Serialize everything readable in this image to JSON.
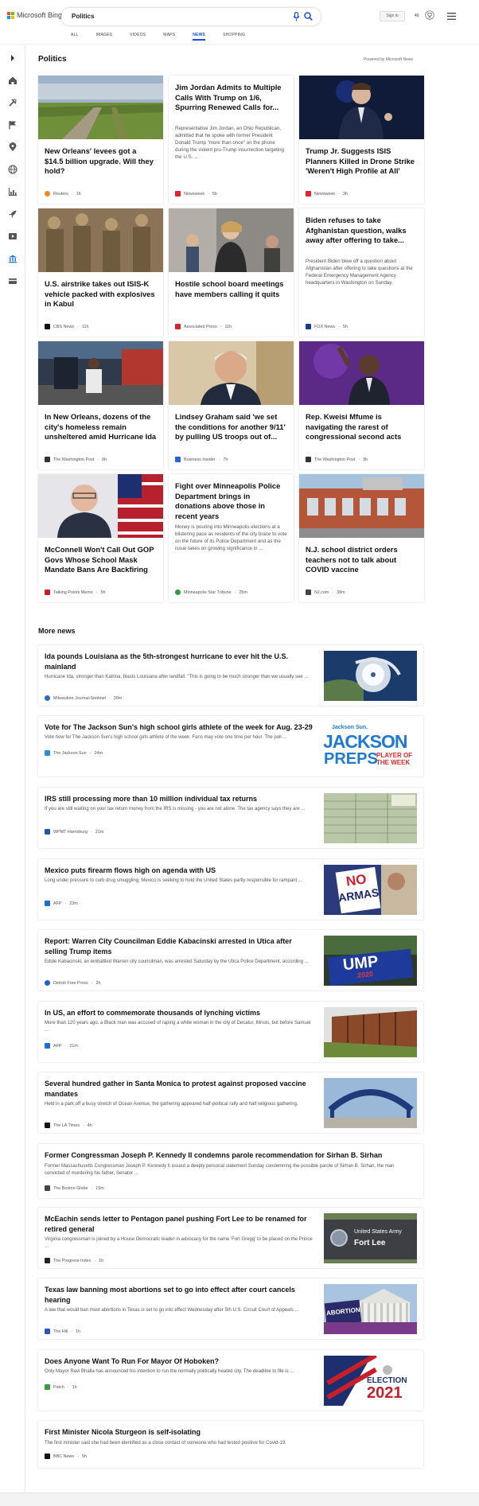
{
  "header": {
    "logo_text": "Microsoft Bing",
    "search_query": "Politics",
    "signin_label": "Sign in",
    "points": "40",
    "tabs": [
      {
        "label": "ALL",
        "active": false
      },
      {
        "label": "IMAGES",
        "active": false
      },
      {
        "label": "VIDEOS",
        "active": false
      },
      {
        "label": "MAPS",
        "active": false
      },
      {
        "label": "NEWS",
        "active": true
      },
      {
        "label": "SHOPPING",
        "active": false
      }
    ]
  },
  "rail_icons": [
    "chevron-right-icon",
    "home-icon",
    "tools-icon",
    "flag-icon",
    "location-icon",
    "globe-icon",
    "chart-icon",
    "rocket-icon",
    "film-icon",
    "bank-icon",
    "wallet-icon"
  ],
  "section": {
    "title": "Politics",
    "powered_by": "Powered by Microsoft News"
  },
  "cards": [
    {
      "title": "New Orleans' levees got a $14.5 billion upgrade. Will they hold?",
      "description": "",
      "source": "Reuters",
      "time": "1h",
      "has_image": true,
      "source_color": "#f08a24"
    },
    {
      "title": "Jim Jordan Admits to Multiple Calls With Trump on 1/6, Spurring Renewed Calls for...",
      "description": "Representative Jim Jordan, an Ohio Republican, admitted that he spoke with former President Donald Trump \"more than once\" on the phone during the violent pro-Trump insurrection targeting the U.S. ...",
      "source": "Newsweek",
      "time": "5h",
      "has_image": false,
      "source_color": "#e0252d"
    },
    {
      "title": "Trump Jr. Suggests ISIS Planners Killed in Drone Strike 'Weren't High Profile at All'",
      "description": "",
      "source": "Newsweek",
      "time": "3h",
      "has_image": true,
      "source_color": "#e0252d"
    },
    {
      "title": "U.S. airstrike takes out ISIS-K vehicle packed with explosives in Kabul",
      "description": "",
      "source": "CBS News",
      "time": "11h",
      "has_image": true,
      "source_color": "#111111"
    },
    {
      "title": "Hostile school board meetings have members calling it quits",
      "description": "",
      "source": "Associated Press",
      "time": "11h",
      "has_image": true,
      "source_color": "#d9232b"
    },
    {
      "title": "Biden refuses to take Afghanistan question, walks away after offering to take...",
      "description": "President Biden blew off a question about Afghanistan after offering to take questions at the Federal Emergency Management Agency headquarters in Washington on Sunday.",
      "source": "FOX News",
      "time": "5h",
      "has_image": false,
      "source_color": "#1a3c8a"
    },
    {
      "title": "In New Orleans, dozens of the city's homeless remain unsheltered amid Hurricane Ida",
      "description": "",
      "source": "The Washington Post",
      "time": "6h",
      "has_image": true,
      "source_color": "#333333"
    },
    {
      "title": "Lindsey Graham said 'we set the conditions for another 9/11' by pulling US troops out of...",
      "description": "",
      "source": "Business Insider",
      "time": "7h",
      "has_image": true,
      "source_color": "#2a62d9"
    },
    {
      "title": "Rep. Kweisi Mfume is navigating the rarest of congressional second acts",
      "description": "",
      "source": "The Washington Post",
      "time": "3h",
      "has_image": true,
      "source_color": "#333333"
    },
    {
      "title": "McConnell Won't Call Out GOP Govs Whose School Mask Mandate Bans Are Backfiring",
      "description": "",
      "source": "Talking Points Memo",
      "time": "5h",
      "has_image": true,
      "source_color": "#c8202a"
    },
    {
      "title": "Fight over Minneapolis Police Department brings in donations above those in recent years",
      "description": "Money is pouring into Minneapolis elections at a blistering pace as residents of the city brace to vote on the future of its Police Department and as the issue takes on growing significance in ...",
      "source": "Minneapolis Star Tribune",
      "time": "25m",
      "has_image": false,
      "source_color": "#2e9d46"
    },
    {
      "title": "N.J. school district orders teachers not to talk about COVID vaccine",
      "description": "",
      "source": "NJ.com",
      "time": "38m",
      "has_image": true,
      "source_color": "#444444"
    }
  ],
  "more_news": {
    "title": "More news",
    "items": [
      {
        "title": "Ida pounds Louisiana as the 5th-strongest hurricane to ever hit the U.S. mainland",
        "description": "Hurricane Ida, stronger than Katrina, blasts Louisiana after landfall: \"This is going to be much stronger than we usually see ...",
        "source": "Milwaukee Journal-Sentinel",
        "time": "30m",
        "thumb": "hurricane",
        "source_color": "#2c6fb7"
      },
      {
        "title": "Vote for The Jackson Sun's high school girls athlete of the week for Aug. 23-29",
        "description": "Vote now for The Jackson Sun's high school girls athlete of the week. Fans may vote one time per hour. The poll ...",
        "source": "The Jackson Sun",
        "time": "24m",
        "thumb": "jackson",
        "source_color": "#2a8fd6",
        "thumb_text": {
          "line1": "Jackson Sun.",
          "line2": "JACKSON",
          "line3": "PREPS",
          "line4": "PLAYER OF THE WEEK"
        }
      },
      {
        "title": "IRS still processing more than 10 million individual tax returns",
        "description": "If you are still waiting on your tax return money from the IRS is missing - you are not alone. The tax agency says they are ...",
        "source": "WPMT Harrisburg",
        "time": "21m",
        "thumb": "irs",
        "source_color": "#2255aa"
      },
      {
        "title": "Mexico puts firearm flows high on agenda with US",
        "description": "Long under pressure to curb drug smuggling, Mexico is seeking to hold the United States partly responsible for rampant ...",
        "source": "AFP",
        "time": "23m",
        "thumb": "mexico",
        "source_color": "#1d6fd1",
        "thumb_text": {
          "line1": "NO",
          "line2": "ARMAS"
        }
      },
      {
        "title": "Report: Warren City Councilman Eddie Kabacinski arrested in Utica after selling Trump items",
        "description": "Eddie Kabacinski, an embattled Warren city councilman, was arrested Saturday by the Utica Police Department, according ...",
        "source": "Detroit Free Press",
        "time": "2h",
        "thumb": "trump",
        "source_color": "#1c61c4",
        "thumb_text": {
          "line1": "UMP",
          "line2": "2020"
        }
      },
      {
        "title": "In US, an effort to commemorate thousands of lynching victims",
        "description": "More than 120 years ago, a Black man was accused of raping a white woman in the city of Decatur, Illinois, but before Samuel ...",
        "source": "AFP",
        "time": "21m",
        "thumb": "memorial",
        "source_color": "#1d6fd1"
      },
      {
        "title": "Several hundred gather in Santa Monica to protest against proposed vaccine mandates",
        "description": "Held in a park off a busy stretch of Ocean Avenue, the gathering appeared half-political rally and half religious gathering.",
        "source": "The LA Times",
        "time": "4h",
        "thumb": "pier",
        "source_color": "#111111"
      },
      {
        "title": "Former Congressman Joseph P. Kennedy II condemns parole recommendation for Sirhan B. Sirhan",
        "description": "Former Massachusetts Congressman Joseph P. Kennedy II issued a deeply personal statement Sunday condemning the possible parole of Sirhan B. Sirhan, the man convicted of murdering his father, Senator ...",
        "source": "The Boston Globe",
        "time": "15m",
        "thumb": "",
        "source_color": "#444444"
      },
      {
        "title": "McEachin sends letter to Pentagon panel pushing Fort Lee to be renamed for retired general",
        "description": "Virginia congressman is joined by a House Democratic leader in advocacy for the name 'Fort Gregg' to be placed on the Prince ...",
        "source": "The Progress-Index",
        "time": "1h",
        "thumb": "fortlee",
        "source_color": "#222222",
        "thumb_text": {
          "line1": "United States Army",
          "line2": "Fort Lee"
        }
      },
      {
        "title": "Texas law banning most abortions set to go into effect after court cancels hearing",
        "description": "A law that would ban most abortions in Texas is set to go into effect Wednesday after 5th U.S. Circuit Court of Appeals ...",
        "source": "The Hill",
        "time": "1h",
        "thumb": "court",
        "source_color": "#2b55b8",
        "thumb_text": {
          "line1": "ABORTION"
        }
      },
      {
        "title": "Does Anyone Want To Run For Mayor Of Hoboken?",
        "description": "Only Mayor Ravi Bhalla has announced his intention to run the normally politically heated city. The deadline to file is ...",
        "source": "Patch",
        "time": "1h",
        "thumb": "election",
        "source_color": "#3a9d3a",
        "thumb_text": {
          "line1": "ELECTION",
          "line2": "2021"
        }
      },
      {
        "title": "First Minister Nicola Sturgeon is self-isolating",
        "description": "The first minister said she had been identified as a close contact of someone who had tested positive for Covid-19.",
        "source": "BBC News",
        "time": "5h",
        "thumb": "",
        "source_color": "#111111"
      }
    ]
  },
  "colors": {
    "accent": "#174ae4",
    "border": "#e5e5e5"
  }
}
